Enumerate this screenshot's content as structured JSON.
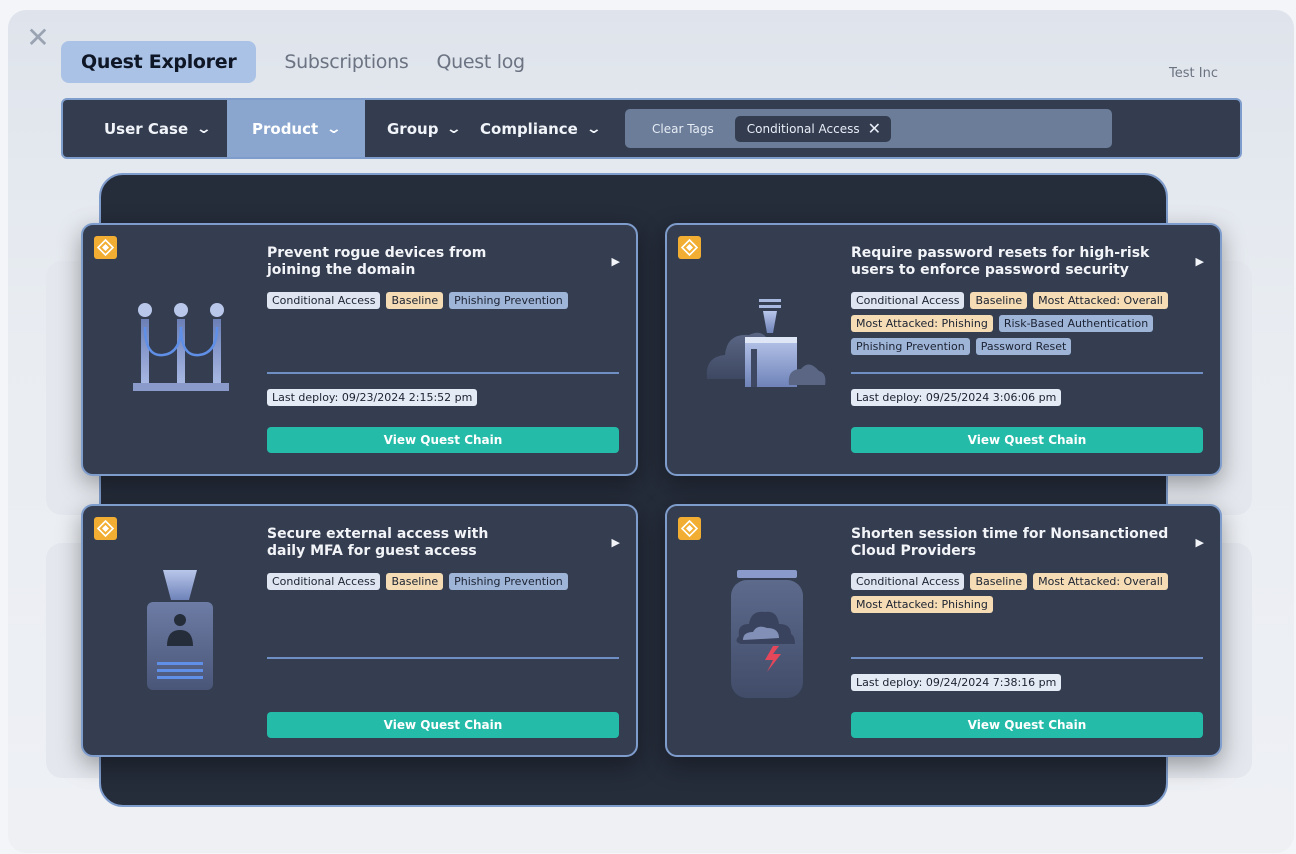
{
  "header": {
    "tabs": [
      {
        "label": "Quest Explorer",
        "active": true
      },
      {
        "label": "Subscriptions",
        "active": false
      },
      {
        "label": "Quest log",
        "active": false
      }
    ],
    "org_name": "Test Inc"
  },
  "filters": {
    "items": [
      {
        "label": "User Case",
        "active": false
      },
      {
        "label": "Product",
        "active": true
      },
      {
        "label": "Group",
        "active": false
      },
      {
        "label": "Compliance",
        "active": false
      }
    ],
    "clear_tags_label": "Clear Tags",
    "selected_tags": [
      "Conditional Access"
    ]
  },
  "cards": [
    {
      "title": "Prevent rogue devices from joining the domain",
      "tags": [
        "Conditional Access",
        "Baseline",
        "Phishing Prevention"
      ],
      "last_deploy": "Last deploy: 09/23/2024 2:15:52 pm",
      "button": "View Quest Chain",
      "icon": "barrier-icon"
    },
    {
      "title": "Require password resets for high-risk users to enforce password security",
      "tags": [
        "Conditional Access",
        "Baseline",
        "Most Attacked: Overall",
        "Most Attacked: Phishing",
        "Risk-Based Authentication",
        "Phishing Prevention",
        "Password Reset"
      ],
      "last_deploy": "Last deploy: 09/25/2024 3:06:06 pm",
      "button": "View Quest Chain",
      "icon": "cloud-factory-icon"
    },
    {
      "title": "Secure external access with daily MFA for guest access",
      "tags": [
        "Conditional Access",
        "Baseline",
        "Phishing Prevention"
      ],
      "last_deploy": "",
      "button": "View Quest Chain",
      "icon": "id-badge-icon"
    },
    {
      "title": "Shorten session time for Nonsanctioned Cloud Providers",
      "tags": [
        "Conditional Access",
        "Baseline",
        "Most Attacked: Overall",
        "Most Attacked: Phishing"
      ],
      "last_deploy": "Last deploy: 09/24/2024 7:38:16 pm",
      "button": "View Quest Chain",
      "icon": "storm-jar-icon"
    }
  ],
  "colors": {
    "accent": "#24bba9",
    "badge": "#f2ae32",
    "card_bg": "#353e51",
    "border": "#7f9dcc"
  }
}
